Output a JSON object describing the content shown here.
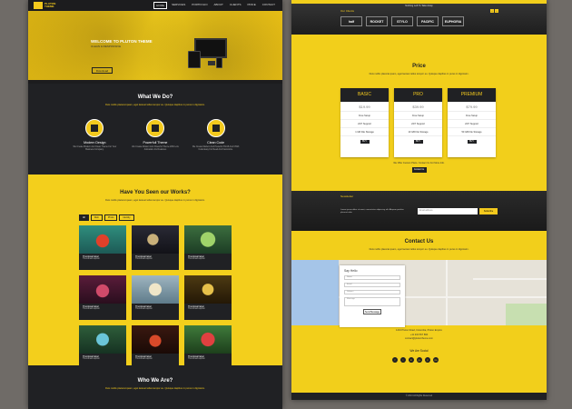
{
  "left": {
    "logo": {
      "line1": "PLUTON",
      "line2": "THEME"
    },
    "nav": [
      "HOME",
      "SERVICES",
      "PORTFOLIO",
      "ABOUT",
      "CLIENTS",
      "PRICE",
      "CONTACT"
    ],
    "hero": {
      "title": "WELCOME TO PLUTON THEME",
      "subtitle": "CLEAN & RESPONSIVE",
      "button": "Download"
    },
    "services": {
      "title": "What We Do?",
      "desc": "Duis mollis placerat quam, eget laoreet tellus tempor eu. Quisque dapibus in purus in dignissim.",
      "features": [
        {
          "name": "Modern Design",
          "text": "We Create Modern And Clean Theme For Your Business Company.",
          "icon": "monitor-icon"
        },
        {
          "name": "Powerfull Theme",
          "text": "We Create Modern And Powerful Theme With Lots Animation And Features",
          "icon": "document-icon"
        },
        {
          "name": "Clean Code",
          "text": "We Create Modern And Powerful Html5 And CSS3 Code Easy For Read And Customize.",
          "icon": "printer-icon"
        }
      ]
    },
    "works": {
      "title": "Have You Seen our Works?",
      "desc": "Duis mollis placerat quam, eget laoreet tellus tempor eu. Quisque dapibus in purus in dignissim.",
      "filters": [
        "All",
        "Web",
        "Photo",
        "Identity"
      ],
      "items": [
        {
          "label": "Thumbnail label",
          "caption": "Thumbnail caption"
        },
        {
          "label": "Thumbnail label",
          "caption": "Thumbnail caption"
        },
        {
          "label": "Thumbnail label",
          "caption": "Thumbnail caption"
        },
        {
          "label": "Thumbnail label",
          "caption": "Thumbnail caption"
        },
        {
          "label": "Thumbnail label",
          "caption": "Thumbnail caption"
        },
        {
          "label": "Thumbnail label",
          "caption": "Thumbnail caption"
        },
        {
          "label": "Thumbnail label",
          "caption": "Thumbnail caption"
        },
        {
          "label": "Thumbnail label",
          "caption": "Thumbnail caption"
        },
        {
          "label": "Thumbnail label",
          "caption": "Thumbnail caption"
        }
      ]
    },
    "who": {
      "title": "Who We Are?",
      "desc": "Duis mollis placerat quam, eget laoreet tellus tempor eu. Quisque dapibus in purus in dignissim."
    }
  },
  "right": {
    "top_text": "Nothing Left To Take Away",
    "clients": {
      "title": "Our Clients",
      "logos": [
        "half",
        "ROCKET",
        "STYLO",
        "PACIFIC",
        "EUPHORIA"
      ]
    },
    "price": {
      "title": "Price",
      "desc": "Duis mollis placerat quam, eget laoreet tellus tempor eu. Quisque dapibus in purus in dignissim.",
      "plans": [
        {
          "name": "BASIC",
          "price": "$19.99",
          "f1": "Free Setup",
          "f2": "24/7 Support",
          "f3": "1 GB File Storage",
          "button": "BUY"
        },
        {
          "name": "PRO",
          "price": "$39.99",
          "f1": "Free Setup",
          "f2": "24/7 Support",
          "f3": "10 GB File Storage",
          "button": "BUY"
        },
        {
          "name": "PREMIUM",
          "price": "$79.99",
          "f1": "Free Setup",
          "f2": "24/7 Support",
          "f3": "50 GB File Storage",
          "button": "BUY"
        }
      ],
      "note": "We Offer Custom Plans. Contact Us For More Info.",
      "note_button": "Contact Us"
    },
    "newsletter": {
      "title": "Newsletter",
      "text": "Lorem ipsum dolor sit amet, consectetur adipiscing elit. Aliquam porttitor placerat odio.",
      "placeholder": "Email address",
      "button": "Subscribe"
    },
    "contact": {
      "title": "Contact Us",
      "desc": "Duis mollis placerat quam, eget laoreet tellus tempor eu. Quisque dapibus in purus in dignissim.",
      "form_title": "Say Hello",
      "fields": [
        "Name",
        "Email",
        "Subject",
        "Message"
      ],
      "send": "Send Message",
      "address": "1234 Pluton Road, Columbia, Pluton Empire",
      "phone": "+11 234 567 890",
      "email": "contact@plutontheme.com",
      "social_title": "We Are Social",
      "socials": [
        "f",
        "t",
        "in",
        "g+",
        "p",
        "rss"
      ],
      "footer": "© 2013 All Rights Reserved"
    }
  }
}
